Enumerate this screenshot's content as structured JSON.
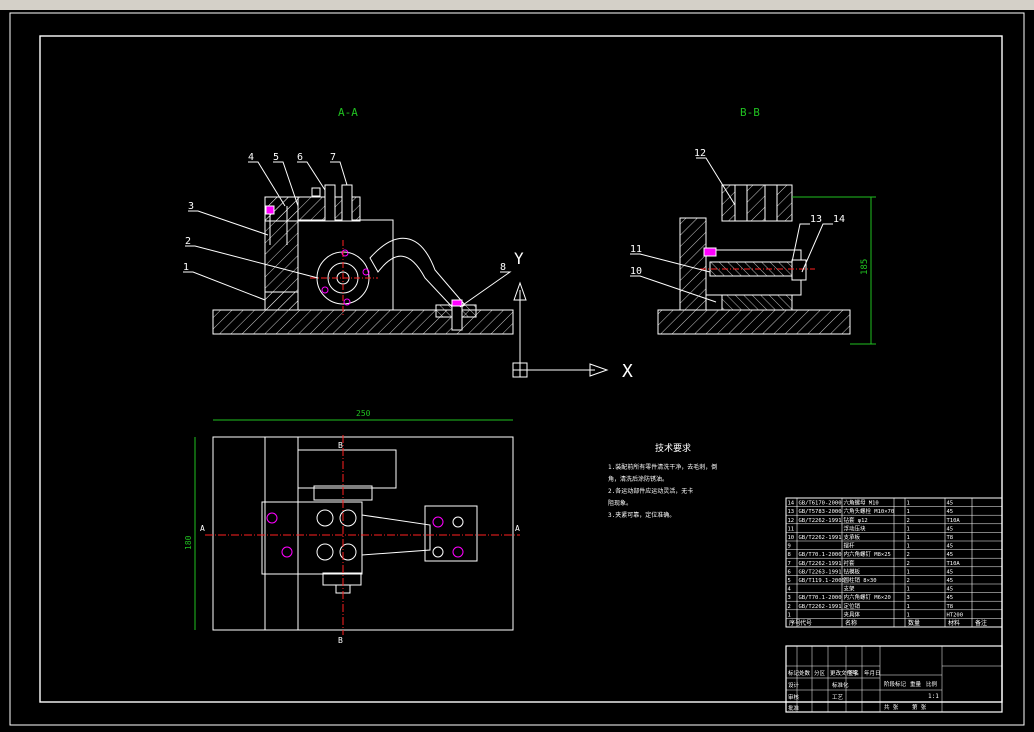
{
  "colors": {
    "background": "#000000",
    "outline": "#ffffff",
    "hatch": "#ffffff",
    "centerline": "#ff2020",
    "dimension": "#20c020",
    "view_label": "#20c020",
    "accent_magenta": "#ff00ff"
  },
  "views": {
    "section_aa": "A-A",
    "section_bb": "B-B"
  },
  "balloons_left": [
    "4",
    "5",
    "6",
    "7",
    "3",
    "2",
    "1",
    "8"
  ],
  "balloons_right": [
    "12",
    "13",
    "14",
    "11",
    "10"
  ],
  "axes": {
    "x_label": "X",
    "y_label": "Y"
  },
  "dimensions": {
    "bb_height": "185",
    "plan_width": "250",
    "plan_height": "180"
  },
  "section_marks": {
    "a_left": "A",
    "a_right": "A",
    "b_top": "B",
    "b_bottom": "B"
  },
  "notes": {
    "title": "技术要求",
    "lines": [
      "1.装配前所有零件清洗干净，去毛刺，倒",
      "角，清洗后涂防锈油。",
      "2.各运动部件应运动灵活，无卡",
      "阻现象。",
      "3.夹紧可靠，定位准确。"
    ]
  },
  "bom": {
    "rows": [
      [
        "14",
        "GB/T6170-2000",
        "六角螺母 M10",
        "1",
        "45",
        ""
      ],
      [
        "13",
        "GB/T5783-2000",
        "六角头螺栓 M10×70",
        "1",
        "45",
        ""
      ],
      [
        "12",
        "GB/T2262-1991",
        "钻套 φ12",
        "2",
        "T10A",
        ""
      ],
      [
        "11",
        "",
        "浮动压块",
        "1",
        "45",
        ""
      ],
      [
        "10",
        "GB/T2262-1991",
        "支承板",
        "1",
        "T8",
        ""
      ],
      [
        "9",
        "",
        "摆杆",
        "1",
        "45",
        ""
      ],
      [
        "8",
        "GB/T70.1-2000",
        "内六角螺钉 M8×25",
        "2",
        "45",
        ""
      ],
      [
        "7",
        "GB/T2262-1991",
        "衬套",
        "2",
        "T10A",
        ""
      ],
      [
        "6",
        "GB/T2263-1991",
        "钻模板",
        "1",
        "45",
        ""
      ],
      [
        "5",
        "GB/T119.1-2000",
        "圆柱销 8×30",
        "2",
        "45",
        ""
      ],
      [
        "4",
        "",
        "支架",
        "1",
        "45",
        ""
      ],
      [
        "3",
        "GB/T70.1-2000",
        "内六角螺钉 M6×20",
        "3",
        "45",
        ""
      ],
      [
        "2",
        "GB/T2262-1991",
        "定位销",
        "1",
        "T8",
        ""
      ],
      [
        "1",
        "",
        "夹具体",
        "1",
        "HT200",
        ""
      ]
    ],
    "header": [
      "序号",
      "代号",
      "名称",
      "数量",
      "材料",
      "备注"
    ]
  },
  "title_block": {
    "labels": [
      "标记",
      "处数",
      "分区",
      "更改文件号",
      "签名",
      "年月日",
      "设计",
      "标准化",
      "阶段标记",
      "重量",
      "比例",
      "审核",
      "工艺",
      "批准",
      "共 张",
      "第 张"
    ],
    "scale": "1:1"
  }
}
